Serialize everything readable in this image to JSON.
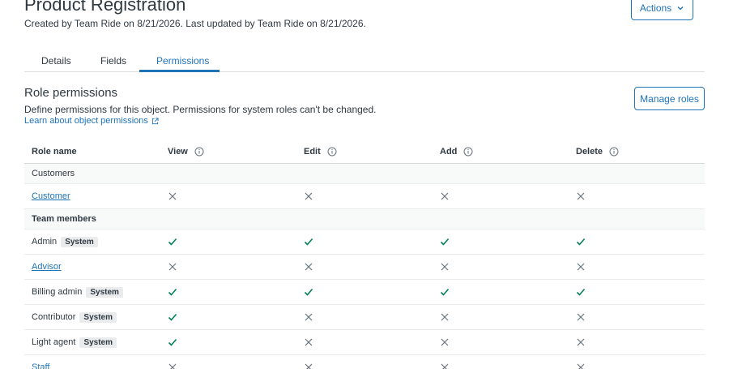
{
  "header": {
    "title": "Product Registration",
    "subtitle": "Created by Team Ride on 8/21/2026. Last updated by Team Ride on 8/21/2026.",
    "actions_label": "Actions"
  },
  "tabs": [
    {
      "label": "Details",
      "active": false
    },
    {
      "label": "Fields",
      "active": false
    },
    {
      "label": "Permissions",
      "active": true
    }
  ],
  "section": {
    "title": "Role permissions",
    "description": "Define permissions for this object. Permissions for system roles can't be changed.",
    "link_label": "Learn about object permissions",
    "manage_label": "Manage roles"
  },
  "table": {
    "columns": [
      "Role name",
      "View",
      "Edit",
      "Add",
      "Delete"
    ],
    "rows": [
      {
        "type": "group",
        "label": "Customers",
        "bold": false
      },
      {
        "type": "role",
        "name": "Customer",
        "link": true,
        "badge": "",
        "view": false,
        "edit": false,
        "add": false,
        "delete": false
      },
      {
        "type": "group",
        "label": "Team members",
        "bold": true
      },
      {
        "type": "role",
        "name": "Admin",
        "link": false,
        "badge": "System",
        "view": true,
        "edit": true,
        "add": true,
        "delete": true
      },
      {
        "type": "role",
        "name": "Advisor",
        "link": true,
        "badge": "",
        "view": false,
        "edit": false,
        "add": false,
        "delete": false
      },
      {
        "type": "role",
        "name": "Billing admin",
        "link": false,
        "badge": "System",
        "view": true,
        "edit": true,
        "add": true,
        "delete": true
      },
      {
        "type": "role",
        "name": "Contributor",
        "link": false,
        "badge": "System",
        "view": true,
        "edit": false,
        "add": false,
        "delete": false
      },
      {
        "type": "role",
        "name": "Light agent",
        "link": false,
        "badge": "System",
        "view": true,
        "edit": false,
        "add": false,
        "delete": false
      },
      {
        "type": "role",
        "name": "Staff",
        "link": true,
        "badge": "",
        "view": false,
        "edit": false,
        "add": false,
        "delete": false
      }
    ]
  },
  "colors": {
    "accent": "#1f73b7",
    "check": "#038153",
    "cross": "#68737d",
    "text": "#2f3941"
  },
  "icons": {
    "actions": "chevron-down-icon",
    "link": "external-link-icon",
    "info": "info-icon",
    "allowed": "check-icon",
    "denied": "close-icon"
  }
}
